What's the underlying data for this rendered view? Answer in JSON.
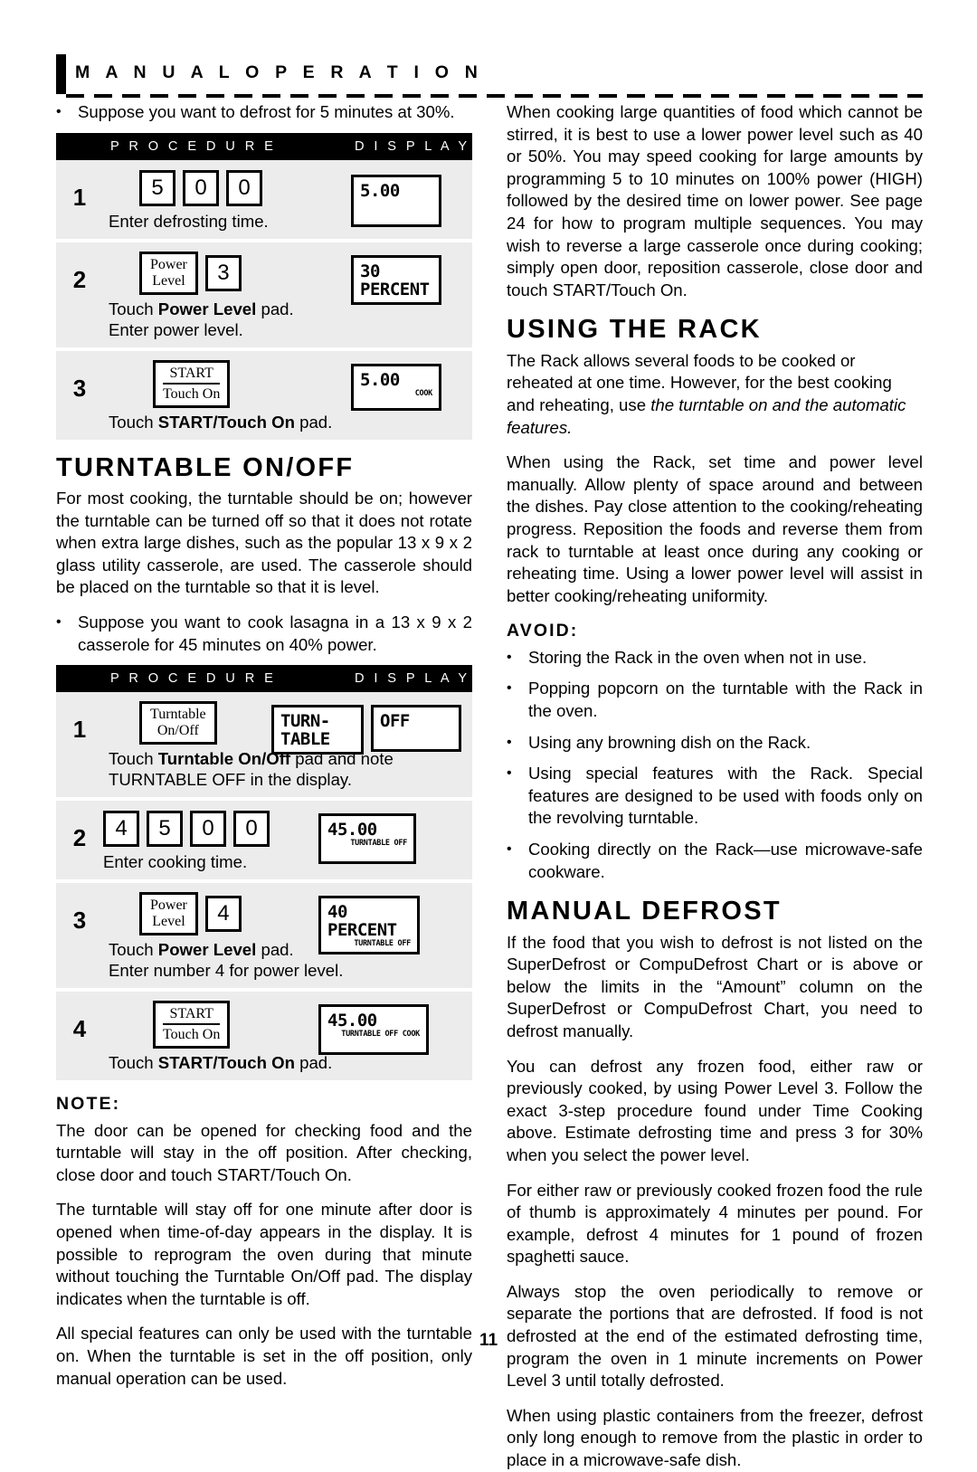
{
  "runhead": {
    "label": "M A N U A L   O P E R A T I O N"
  },
  "page_number": "11",
  "left": {
    "intro_bullet": "Suppose you want to defrost for 5 minutes at 30%.",
    "table1": {
      "col_procedure": "P R O C E D U R E",
      "col_display": "D I S P L A Y",
      "rows": [
        {
          "step": "1",
          "pads": [
            "5",
            "0",
            "0"
          ],
          "caption": "Enter defrosting time.",
          "display_main": "5.00",
          "display_sub": ""
        },
        {
          "step": "2",
          "pad_power_line1": "Power",
          "pad_power_line2": "Level",
          "pads": [
            "3"
          ],
          "caption_line1_pre": "Touch ",
          "caption_line1_bold": "Power Level",
          "caption_line1_post": " pad.",
          "caption_line2": "Enter power level.",
          "display_main": "30\nPERCENT",
          "display_sub": ""
        },
        {
          "step": "3",
          "pad_start_top": "START",
          "pad_start_bottom": "Touch On",
          "caption_pre": "Touch ",
          "caption_bold": "START/Touch On",
          "caption_post": " pad.",
          "display_main": "5.00",
          "display_sub": "COOK"
        }
      ]
    },
    "heading_turntable": "TURNTABLE ON/OFF",
    "turntable_p1": "For most cooking, the turntable should be on; however the turntable can be turned off so that it does not rotate when extra large dishes, such as the popular 13 x 9 x 2 glass utility casserole, are used. The casserole should be placed on the turntable so that it is level.",
    "turntable_bullet": "Suppose you want to cook lasagna in a 13 x 9 x 2 casserole for 45 minutes on 40% power.",
    "table2": {
      "col_procedure": "P R O C E D U R E",
      "col_display": "D I S P L A Y",
      "rows": [
        {
          "step": "1",
          "pad_tt_line1": "Turntable",
          "pad_tt_line2": "On/Off",
          "caption_line1_pre": "Touch ",
          "caption_line1_bold": "Turntable On/Off",
          "caption_line1_post": " pad and note",
          "caption_line2": "TURNTABLE OFF in the display.",
          "display_main": "TURN-\nTABLE",
          "display_main2": "OFF",
          "display_sub": ""
        },
        {
          "step": "2",
          "pads": [
            "4",
            "5",
            "0",
            "0"
          ],
          "caption": "Enter cooking time.",
          "display_main": "45.00",
          "display_sub": "TURNTABLE OFF"
        },
        {
          "step": "3",
          "pad_power_line1": "Power",
          "pad_power_line2": "Level",
          "pads": [
            "4"
          ],
          "caption_line1_pre": "Touch ",
          "caption_line1_bold": "Power Level",
          "caption_line1_post": " pad.",
          "caption_line2": "Enter number 4 for power level.",
          "display_main": "40\nPERCENT",
          "display_sub": "TURNTABLE OFF"
        },
        {
          "step": "4",
          "pad_start_top": "START",
          "pad_start_bottom": "Touch On",
          "caption_pre": "Touch ",
          "caption_bold": "START/Touch On",
          "caption_post": " pad.",
          "display_main": "45.00",
          "display_sub": "TURNTABLE OFF COOK"
        }
      ]
    },
    "note_heading": "NOTE:",
    "note_p1": "The door can be opened for checking food and the turntable will stay in the off position. After checking, close door and touch START/Touch On.",
    "note_p2": "The turntable will stay off for one minute after door is opened when time-of-day appears in the display. It is possible to reprogram the oven during that minute without touching the Turntable On/Off pad. The display indicates when the turntable is off.",
    "note_p3": "All special features can only be used with the turntable on. When the turntable is set in the off position, only manual operation can be used."
  },
  "right": {
    "p1": "When cooking large quantities of food which cannot be stirred, it is best to use a lower power level such as 40 or 50%. You may speed cooking for large amounts by programming 5 to 10 minutes on 100% power (HIGH) followed by the desired time on lower power. See page 24 for how to program multiple sequences. You may wish to reverse a large casserole once during cooking; simply open door, reposition casserole, close door and touch START/Touch On.",
    "heading_rack": "USING THE RACK",
    "rack_p1_pre": "The Rack allows several foods to be cooked or reheated at one time. However, for the best cooking and reheating, use ",
    "rack_p1_italic": "the turntable on and the automatic features.",
    "rack_p2": "When using the Rack, set time and power level manually. Allow plenty of space around and between the dishes. Pay close attention to the cooking/reheating progress. Reposition the foods and reverse them from rack to turntable at least once during any cooking or reheating time. Using a lower power level will assist in better cooking/reheating uniformity.",
    "avoid_heading": "AVOID:",
    "avoid_items": [
      "Storing the Rack in the oven when not in use.",
      "Popping popcorn on the turntable with the Rack in the oven.",
      "Using any browning dish on the Rack.",
      "Using special features with the Rack. Special features are designed to be used with foods only on the revolving turntable.",
      "Cooking directly on the Rack—use microwave-safe cookware."
    ],
    "heading_defrost": "MANUAL DEFROST",
    "defrost_p1": "If the food that you wish to defrost is not listed on the SuperDefrost or CompuDefrost Chart or is above or below the limits in the “Amount” column on the SuperDefrost or CompuDefrost Chart, you need to defrost manually.",
    "defrost_p2": "You can defrost any frozen food, either raw or previously cooked, by using Power Level 3. Follow the exact 3-step procedure found under Time Cooking above. Estimate defrosting time and press 3 for 30% when you select the power level.",
    "defrost_p3": "For either raw or previously cooked frozen food the rule of thumb is approximately 4 minutes per pound. For example, defrost 4 minutes for 1 pound of frozen spaghetti sauce.",
    "defrost_p4": "Always stop the oven periodically to remove or separate the portions that are defrosted. If food is not defrosted at the end of the estimated defrosting time, program the oven in 1 minute increments on Power Level 3 until totally defrosted.",
    "defrost_p5": "When using plastic containers from the freezer, defrost only long enough to remove from the plastic in order to place in a microwave-safe dish."
  }
}
